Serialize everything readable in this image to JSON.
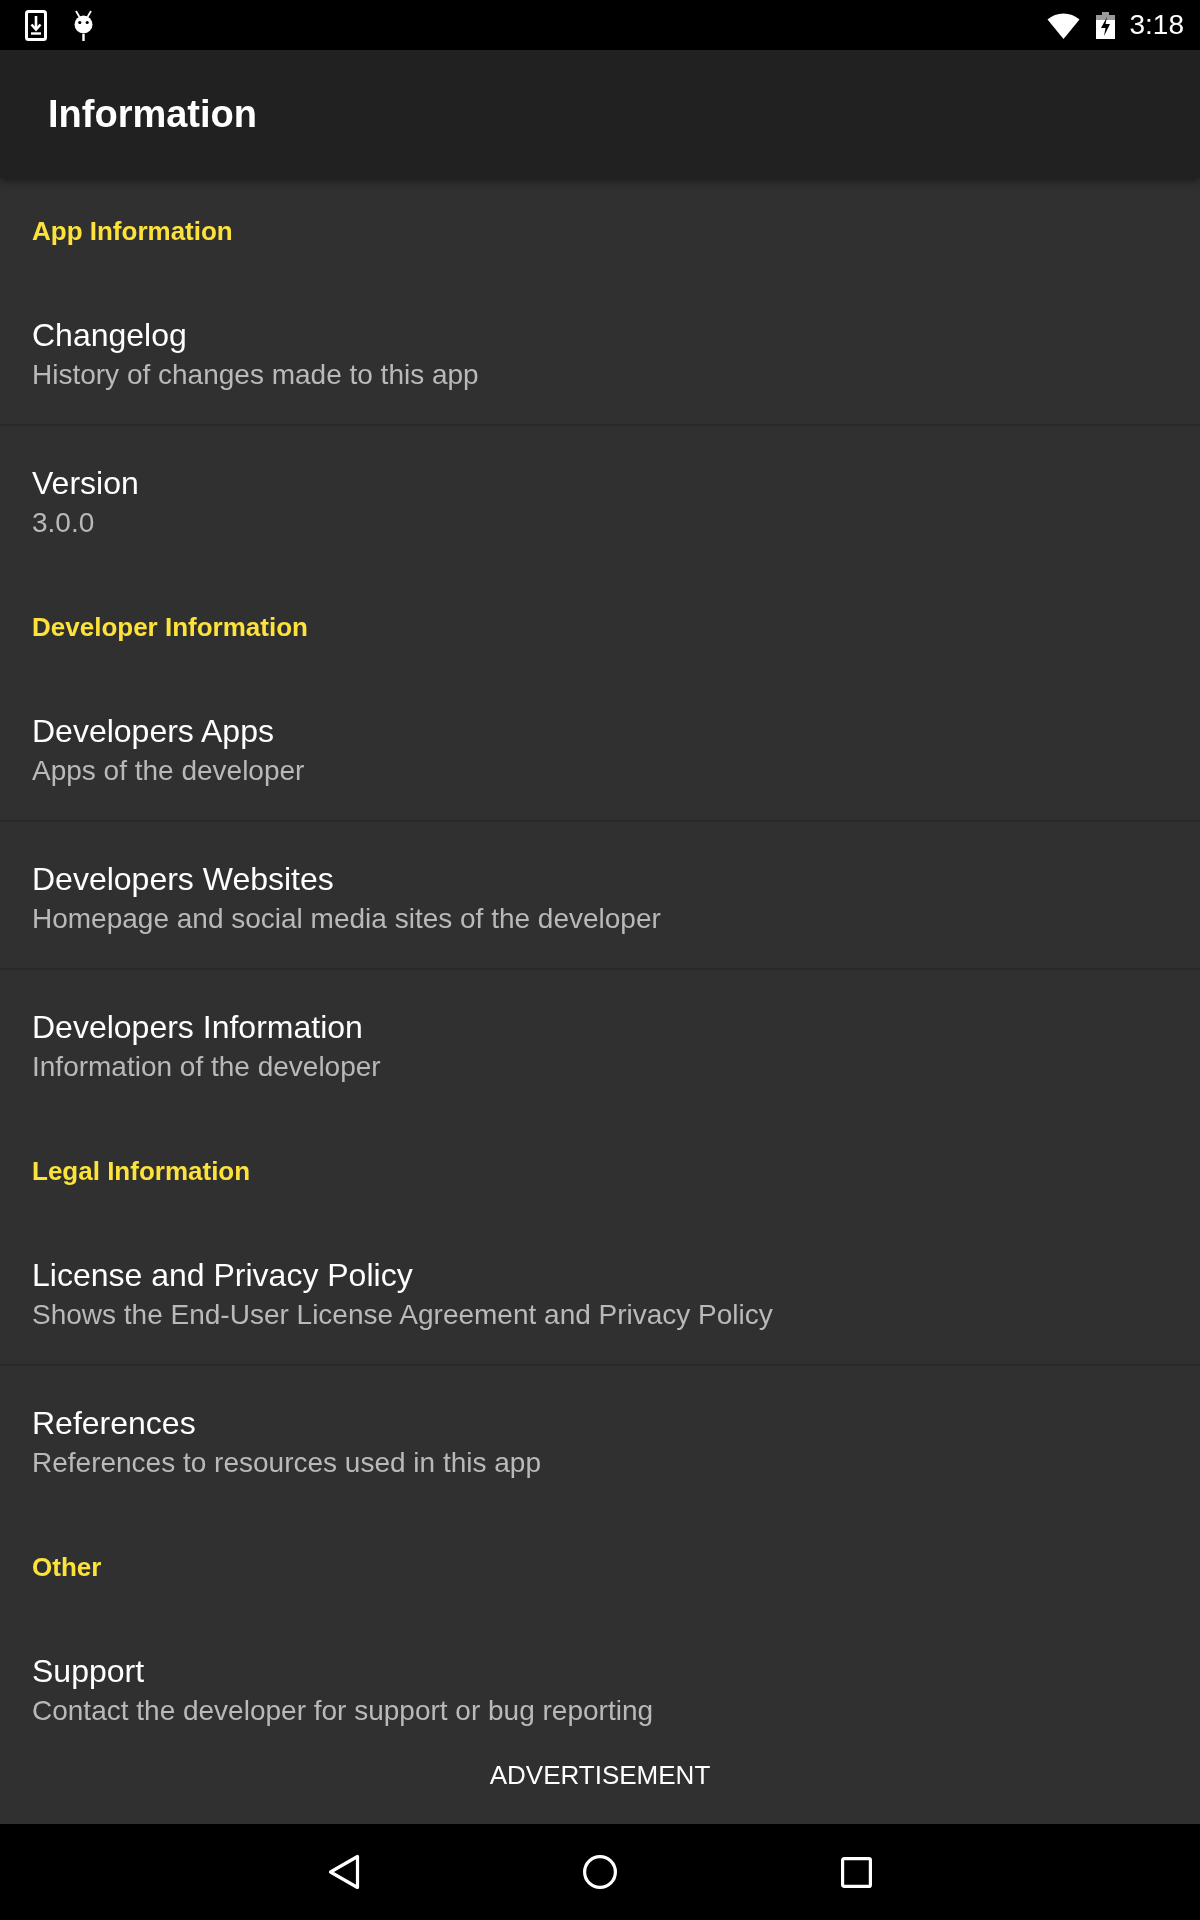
{
  "status_bar": {
    "time": "3:18"
  },
  "app_bar": {
    "title": "Information"
  },
  "sections": [
    {
      "title": "App Information",
      "items": [
        {
          "title": "Changelog",
          "summary": "History of changes made to this app"
        },
        {
          "title": "Version",
          "summary": "3.0.0"
        }
      ]
    },
    {
      "title": "Developer Information",
      "items": [
        {
          "title": "Developers Apps",
          "summary": "Apps of the developer"
        },
        {
          "title": "Developers Websites",
          "summary": "Homepage and social media sites of the developer"
        },
        {
          "title": "Developers Information",
          "summary": "Information of the developer"
        }
      ]
    },
    {
      "title": "Legal Information",
      "items": [
        {
          "title": "License and Privacy Policy",
          "summary": "Shows the End-User License Agreement and Privacy Policy"
        },
        {
          "title": "References",
          "summary": "References to resources used in this app"
        }
      ]
    },
    {
      "title": "Other",
      "items": [
        {
          "title": "Support",
          "summary": "Contact the developer for support or bug reporting"
        }
      ]
    }
  ],
  "advertisement": {
    "label": "ADVERTISEMENT"
  }
}
